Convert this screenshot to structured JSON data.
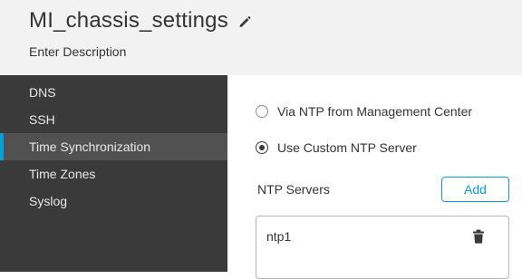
{
  "header": {
    "title": "MI_chassis_settings",
    "description": "Enter Description",
    "edit_icon": "pencil-icon"
  },
  "sidebar": {
    "items": [
      {
        "label": "DNS",
        "active": false
      },
      {
        "label": "SSH",
        "active": false
      },
      {
        "label": "Time Synchronization",
        "active": true
      },
      {
        "label": "Time Zones",
        "active": false
      },
      {
        "label": "Syslog",
        "active": false
      }
    ]
  },
  "main": {
    "options": [
      {
        "label": "Via NTP from Management Center",
        "selected": false
      },
      {
        "label": "Use Custom NTP Server",
        "selected": true
      }
    ],
    "ntp_servers_label": "NTP Servers",
    "add_label": "Add",
    "servers": [
      {
        "name": "ntp1",
        "delete_icon": "trash-icon"
      }
    ]
  },
  "colors": {
    "accent": "#049fd9",
    "sidebar_bg": "#3a3a3a",
    "sidebar_active_bg": "#515151",
    "header_bg": "#f2f2f2"
  }
}
